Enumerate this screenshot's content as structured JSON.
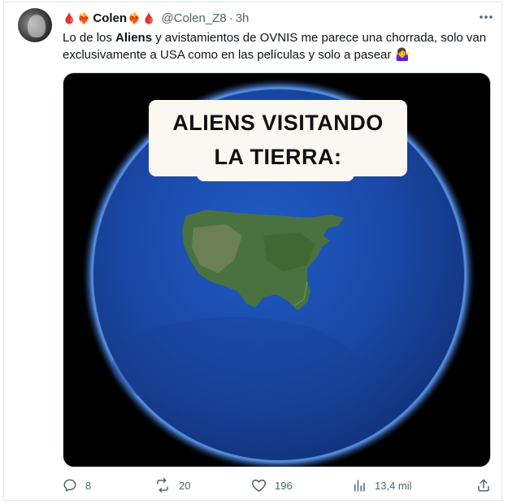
{
  "author": {
    "display_name": "Colen",
    "handle": "@Colen_Z8",
    "time": "3h",
    "separator": "·",
    "emojis": {
      "drop": "🩸",
      "heart": "❤️‍🔥"
    }
  },
  "tweet": {
    "text_before": "Lo de los ",
    "text_bold": "Aliens",
    "text_after": " y avistamientos de OVNIS me parece una chorrada, solo van exclusivamente a USA como en las películas y solo a pasear",
    "text_emoji": "🤷‍♀️"
  },
  "media": {
    "caption_line1": "ALIENS VISITANDO",
    "caption_line2": "LA TIERRA:",
    "colors": {
      "ocean": "#1c4fb0",
      "land": "#3f6b35",
      "caption_bg": "#fbf8f1"
    }
  },
  "actions": {
    "replies": "8",
    "retweets": "20",
    "likes": "196",
    "views": "13,4 mil"
  },
  "icons": [
    "more-icon",
    "reply-icon",
    "retweet-icon",
    "like-icon",
    "views-icon",
    "share-icon"
  ]
}
